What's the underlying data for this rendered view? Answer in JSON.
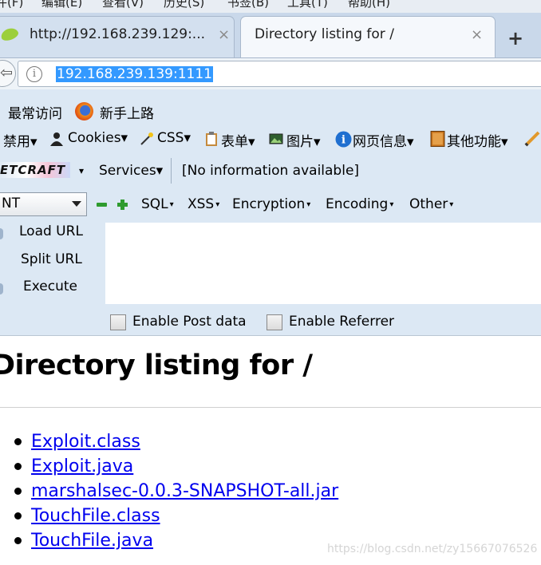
{
  "menu_bar": [
    "件(F)",
    "编辑(E)",
    "查看(V)",
    "历史(S)",
    "书签(B)",
    "工具(T)",
    "帮助(H)"
  ],
  "tabs": [
    {
      "title": "http://192.168.239.129:...",
      "close": "×",
      "active": false
    },
    {
      "title": "Directory listing for /",
      "close": "×",
      "active": true
    }
  ],
  "new_tab_label": "+",
  "navigation": {
    "back_arrow": "⇦",
    "info_icon_glyph": "i",
    "url": "192.168.239.139:1111"
  },
  "bookmarks": {
    "most_visited": "最常访问",
    "getting_started": "新手上路"
  },
  "web_developer": {
    "items": [
      "禁用▾",
      "Cookies▾",
      "CSS▾",
      "表单▾",
      "图片▾",
      "网页信息▾",
      "其他功能▾"
    ]
  },
  "netcraft": {
    "logo": "ETCRAFT",
    "dropdown_caret": "▾",
    "services": "Services▾",
    "info": "[No information available]"
  },
  "hackbar": {
    "select_value": "NT",
    "menus": [
      "SQL",
      "XSS",
      "Encryption",
      "Encoding",
      "Other"
    ],
    "actions": {
      "load": "Load URL",
      "split": "Split URL",
      "execute": "Execute"
    },
    "post_label": "Enable Post data",
    "referrer_label": "Enable Referrer"
  },
  "page": {
    "title": "Directory listing for /",
    "files": [
      "Exploit.class",
      "Exploit.java",
      "marshalsec-0.0.3-SNAPSHOT-all.jar",
      "TouchFile.class",
      "TouchFile.java"
    ]
  },
  "watermark": "https://blog.csdn.net/zy15667076526",
  "colors": {
    "toolbar_bg": "#dce8f4",
    "link": "#0000ee",
    "url_highlight": "#3399ff"
  }
}
